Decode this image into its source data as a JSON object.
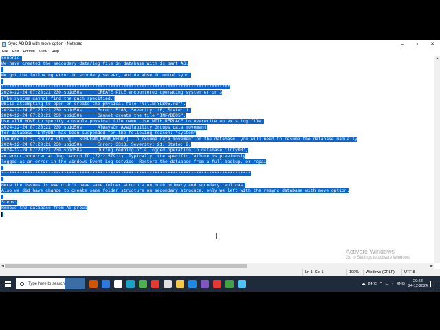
{
  "window": {
    "title": "Sync AO DB with move option - Notepad",
    "controls": [
      "–",
      "▫",
      "✕"
    ]
  },
  "menu": [
    "File",
    "Edit",
    "Format",
    "View",
    "Help"
  ],
  "editor": {
    "lines": [
      "Senerio:",
      "We have created the secondary data/log file in database with is part AG.",
      "",
      "We got the following error in scondary server, and databse in outof sync.",
      "",
      "****************************************************************************************",
      "2024-12-24 07:20:21.230 spid50s      CREATE FILE encountered operating system error 3",
      "(The system cannot find the path specified.)",
      "while attempting to open or create the physical file 'N:\\INFYDB05.ndf'.",
      "2024-12-24 07:20:21.230 spid50s      Error: 5183, Severity: 16, State: 1.",
      "2024-12-24 07:20:21.230 spid50s      Cannot create the file \"INFYDB05\".",
      "Use WITH MOVE to specify a usable physical file name. Use WITH REPLACE to overwrite an existing file.",
      "2024-12-24 07:20:21.230 spid50s      AlwaysOn Availability Groups data movement",
      "for database 'InfyDB' has been suspended for the following reason: \"system\"",
      "(Source ID 2; Source string: 'SUSPEND_FROM_REDO'). To resume data movement on the database, you will need to resume the database manually",
      "2024-12-24 07:20:21.230 spid50s      Error: 3313, Severity: 21, State: 2.",
      "2024-12-24 07:20:21.230 spid50s      During redoing of a logged operation in database 'InfyDB',",
      "an error occurred at log record ID (72:21579:1). Typically, the specific failure is previously",
      "logged as an error in the Windows Event Log service. Restore the database from a full backup, or repai",
      "",
      "************************************************************************************************",
      "",
      "Here the issues is wwe didn't have same folder struture on both primary and scondary replicas.",
      "Also we did have chance to create same folder structure on secondary strucute, only we left with the resync database with move option.",
      "",
      "Steps:",
      "Remove the database from AG group",
      ""
    ]
  },
  "status_bar": {
    "position": "Ln 1, Col 1",
    "zoom": "100%",
    "line_ending": "Windows (CRLF)",
    "encoding": "UTF-8"
  },
  "watermark": {
    "line1": "Activate Windows",
    "line2": "Go to Settings to activate Windows."
  },
  "taskbar": {
    "search_placeholder": "Type here to search",
    "icon_colors": [
      "#d35400",
      "#2a7ae2",
      "#ffffff",
      "#1aa3c8",
      "#4caf50",
      "#e53935",
      "#e0e0e0",
      "#f2c94c",
      "#1e88e5",
      "#7e57c2",
      "#e53935",
      "#43a047",
      "#4fc3f7"
    ],
    "weather": "24°C",
    "language": "ENG",
    "time": "20:58",
    "date": "24-12-2024"
  }
}
